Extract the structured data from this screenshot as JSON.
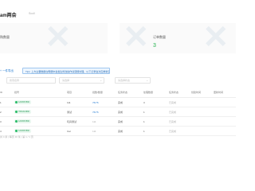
{
  "header": {
    "title": "am两会",
    "subtitle": "Scoll"
  },
  "stats": [
    {
      "label": "购数量",
      "value": ""
    },
    {
      "label": "订单数量",
      "value": "3"
    }
  ],
  "toolbar": {
    "link_label": "+ 一件导出",
    "tip_text": "Tips: 上方主要数据在明细中会发生修改操作请谨慎处理，以下记录会对应重新显示"
  },
  "filters": {
    "search_placeholder": "搜索名称",
    "select_placeholder": "请选择",
    "status_placeholder": "请选择状态"
  },
  "table": {
    "headers": [
      "ID",
      "批号",
      "项目",
      "批数/数量",
      "任务状态",
      "处理数量",
      "任务状态",
      "创建时间",
      "更新时间"
    ],
    "rows": [
      {
        "id": "1",
        "badge": "1234567890",
        "project": "111",
        "count": "76/76",
        "status": "完成",
        "qty": "3",
        "state": "已完成",
        "created": "",
        "updated": ""
      },
      {
        "id": "2",
        "badge": "7654321890",
        "project": "测试",
        "count": "76/76",
        "status": "完成",
        "qty": "1",
        "state": "已完成",
        "created": "",
        "updated": ""
      },
      {
        "id": "3",
        "badge": "1234567890",
        "project": "玩具测试",
        "count": "111",
        "status": "完成",
        "qty": "1",
        "state": "已完成",
        "created": "",
        "updated": ""
      },
      {
        "id": "4",
        "badge": "1234567890",
        "project": "Car",
        "count": "111",
        "status": "完成",
        "qty": "1",
        "state": "已完成",
        "created": "",
        "updated": ""
      }
    ]
  },
  "footer": {
    "text": "共 4 条 | 每页 10 条 | 第 1 / 1 页"
  }
}
